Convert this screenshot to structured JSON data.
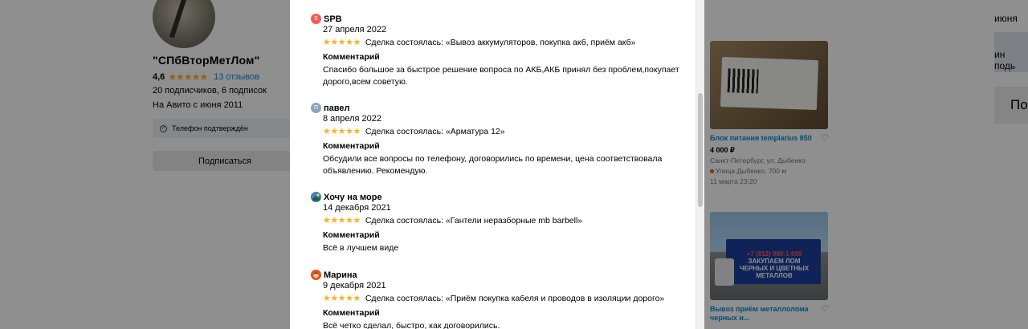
{
  "background": {
    "seller": {
      "name": "\"СПбВторМетЛом\"",
      "rating": "4,6",
      "reviews_link": "13 отзывов",
      "followers": "20 подписчиков, 6 подписок",
      "since": "На Авито с июня 2011",
      "phone_badge": "Телефон подтверждён",
      "subscribe_label": "Подписаться"
    },
    "cards": [
      {
        "title": "Блок питания templarius 850",
        "price": "4 000 ₽",
        "address": "Санкт-Петербург, ул. Дыбенко",
        "metro": "Улица Дыбенко, 700 м",
        "date": "11 марта 23:20"
      },
      {
        "title": "Вывоз приём металлолома черных и...",
        "truck_text": "ЗАКУПАЕМ ЛОМ ЧЕРНЫХ И ЦВЕТНЫХ МЕТАЛЛОВ",
        "truck_phone": "+7 (812) 980-1-999"
      }
    ],
    "right_strip": {
      "word1": "июня",
      "word2": "ин подь",
      "word3": "По"
    }
  },
  "modal": {
    "comment_label": "Комментарий",
    "reviews": [
      {
        "avatar_letter": "S",
        "avatar_color": "#f25c54",
        "name": "SPB",
        "date": "27 апреля 2022",
        "stars": "★★★★★",
        "deal": "Сделка состоялась: «Вывоз аккумуляторов, покупка акб, приём акб»",
        "comment": "Спасибо большое за быстрое решение вопроса по АКБ,АКБ принял без проблем,покупает дорого,всем советую."
      },
      {
        "avatar_letter": "П",
        "avatar_color": "#8aa4ba",
        "name": "павел",
        "date": "8 апреля 2022",
        "stars": "★★★★★",
        "deal": "Сделка состоялась: «Арматура 12»",
        "comment": "Обсудили все вопросы по телефону, договорились по времени, цена соответствовала объявлению. Рекомендую."
      },
      {
        "avatar_letter": "",
        "avatar_color": "#3f84c6",
        "name": "Хочу на море",
        "date": "14 декабря 2021",
        "stars": "★★★★★",
        "deal": "Сделка состоялась: «Гантели неразборные mb barbell»",
        "comment": "Всё в лучшем виде"
      },
      {
        "avatar_letter": "",
        "avatar_color": "#e2562a",
        "name": "Марина",
        "date": "9 декабря 2021",
        "stars": "★★★★★",
        "deal": "Сделка состоялась: «Приём покупка кабеля и проводов в изоляции дорого»",
        "comment": "Всё четко сделал, быстро, как договорились."
      }
    ]
  },
  "colors": {
    "accent_link": "#0a8ad4",
    "star": "#ffb021",
    "overlay": "rgba(0,0,0,0.44)"
  }
}
